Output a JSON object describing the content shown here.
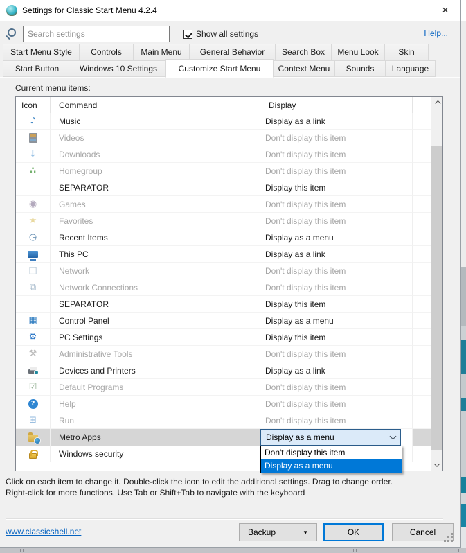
{
  "window": {
    "title": "Settings for Classic Start Menu 4.2.4",
    "close_glyph": "×"
  },
  "search": {
    "placeholder": "Search settings",
    "show_all_label": "Show all settings",
    "show_all_checked": true,
    "help_label": "Help..."
  },
  "tabs": {
    "row1": [
      {
        "label": "Start Menu Style",
        "active": false
      },
      {
        "label": "Controls",
        "active": false
      },
      {
        "label": "Main Menu",
        "active": false
      },
      {
        "label": "General Behavior",
        "active": false
      },
      {
        "label": "Search Box",
        "active": false
      },
      {
        "label": "Menu Look",
        "active": false
      },
      {
        "label": "Skin",
        "active": false
      }
    ],
    "row2": [
      {
        "label": "Start Button",
        "active": false
      },
      {
        "label": "Windows 10 Settings",
        "active": false
      },
      {
        "label": "Customize Start Menu",
        "active": true
      },
      {
        "label": "Context Menu",
        "active": false
      },
      {
        "label": "Sounds",
        "active": false
      },
      {
        "label": "Language",
        "active": false
      }
    ]
  },
  "content": {
    "list_label": "Current menu items:",
    "columns": [
      "Icon",
      "Command",
      "Display"
    ],
    "items": [
      {
        "name": "music",
        "icon": {
          "name": "music-icon",
          "glyph": "♪",
          "color": "#2e7cc0"
        },
        "command": "Music",
        "display": "Display as a link",
        "muted": false
      },
      {
        "name": "videos",
        "icon": {
          "name": "videos-icon",
          "shape": "film"
        },
        "command": "Videos",
        "display": "Don't display this item",
        "muted": true
      },
      {
        "name": "downloads",
        "icon": {
          "name": "downloads-icon",
          "glyph": "↓",
          "color": "#9cc3e5",
          "bold": true
        },
        "command": "Downloads",
        "display": "Don't display this item",
        "muted": true
      },
      {
        "name": "homegroup",
        "icon": {
          "name": "homegroup-icon",
          "glyph": "∴",
          "color": "#74b06e",
          "bold": true
        },
        "command": "Homegroup",
        "display": "Don't display this item",
        "muted": true
      },
      {
        "name": "separator-1",
        "icon": null,
        "command": "SEPARATOR",
        "display": "Display this item",
        "muted": false
      },
      {
        "name": "games",
        "icon": {
          "name": "games-icon",
          "glyph": "◉",
          "color": "#b3a9bd"
        },
        "command": "Games",
        "display": "Don't display this item",
        "muted": true
      },
      {
        "name": "favorites",
        "icon": {
          "name": "favorites-icon",
          "glyph": "★",
          "color": "#e9d9a0"
        },
        "command": "Favorites",
        "display": "Don't display this item",
        "muted": true
      },
      {
        "name": "recent-items",
        "icon": {
          "name": "recent-items-icon",
          "glyph": "◷",
          "color": "#5b87ad",
          "bold": true
        },
        "command": "Recent Items",
        "display": "Display as a menu",
        "muted": false
      },
      {
        "name": "this-pc",
        "icon": {
          "name": "this-pc-icon",
          "shape": "monitor"
        },
        "command": "This PC",
        "display": "Display as a link",
        "muted": false
      },
      {
        "name": "network",
        "icon": {
          "name": "network-icon",
          "glyph": "◫",
          "color": "#a9bccd"
        },
        "command": "Network",
        "display": "Don't display this item",
        "muted": true
      },
      {
        "name": "network-connections",
        "icon": {
          "name": "network-connections-icon",
          "glyph": "⧉",
          "color": "#a9bccd"
        },
        "command": "Network Connections",
        "display": "Don't display this item",
        "muted": true
      },
      {
        "name": "separator-2",
        "icon": null,
        "command": "SEPARATOR",
        "display": "Display this item",
        "muted": false
      },
      {
        "name": "control-panel",
        "icon": {
          "name": "control-panel-icon",
          "glyph": "▦",
          "color": "#2e7cc0"
        },
        "command": "Control Panel",
        "display": "Display as a menu",
        "muted": false
      },
      {
        "name": "pc-settings",
        "icon": {
          "name": "pc-settings-icon",
          "glyph": "⚙",
          "color": "#1f6fc4"
        },
        "command": "PC Settings",
        "display": "Display this item",
        "muted": false
      },
      {
        "name": "administrative-tools",
        "icon": {
          "name": "administrative-tools-icon",
          "glyph": "⚒",
          "color": "#b9b9b9"
        },
        "command": "Administrative Tools",
        "display": "Don't display this item",
        "muted": true
      },
      {
        "name": "devices-and-printers",
        "icon": {
          "name": "devices-and-printers-icon",
          "shape": "printer"
        },
        "command": "Devices and Printers",
        "display": "Display as a link",
        "muted": false
      },
      {
        "name": "default-programs",
        "icon": {
          "name": "default-programs-icon",
          "glyph": "☑",
          "color": "#8fae8f"
        },
        "command": "Default Programs",
        "display": "Don't display this item",
        "muted": true
      },
      {
        "name": "help",
        "icon": {
          "name": "help-icon",
          "glyph": "?",
          "color": "#ffffff",
          "bg": "#2f86d2"
        },
        "command": "Help",
        "display": "Don't display this item",
        "muted": true
      },
      {
        "name": "run",
        "icon": {
          "name": "run-icon",
          "glyph": "⊞",
          "color": "#8fb7dc"
        },
        "command": "Run",
        "display": "Don't display this item",
        "muted": true
      },
      {
        "name": "metro-apps",
        "icon": {
          "name": "metro-apps-icon",
          "shape": "folder"
        },
        "command": "Metro Apps",
        "display": "Display as a menu",
        "muted": false,
        "selected": true,
        "combo_open": true
      },
      {
        "name": "windows-security",
        "icon": {
          "name": "windows-security-icon",
          "shape": "lock"
        },
        "command": "Windows security",
        "display": "",
        "muted": false
      }
    ],
    "footer_line1": "Click on each item to change it. Double-click the icon to edit the additional settings. Drag to change order.",
    "footer_line2": "Right-click for more functions. Use Tab or Shift+Tab to navigate with the keyboard"
  },
  "dropdown": {
    "options": [
      {
        "label": "Don't display this item",
        "highlighted": false
      },
      {
        "label": "Display as a menu",
        "highlighted": true
      }
    ]
  },
  "footer": {
    "link": "www.classicshell.net",
    "backup_label": "Backup",
    "ok_label": "OK",
    "cancel_label": "Cancel"
  },
  "colors": {
    "accent": "#0078d7",
    "link": "#0563c1",
    "window_border": "#8186d5",
    "combo_border": "#2b5d8c",
    "combo_bg": "#dbeaf9",
    "selected_row": "#d6d6d6",
    "muted_text": "#a6a6a6"
  }
}
